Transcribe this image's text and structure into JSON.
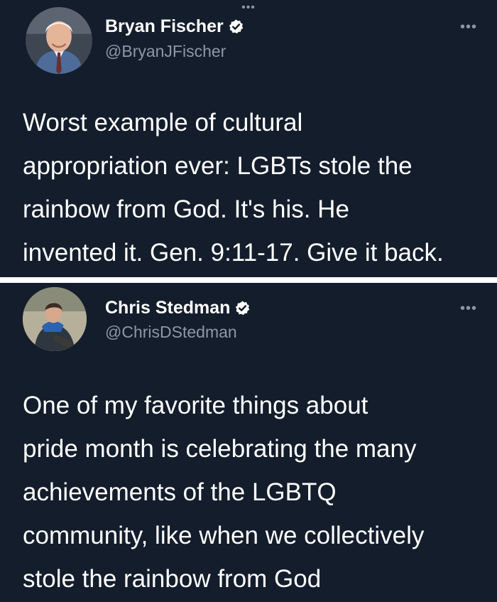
{
  "tweets": [
    {
      "author_name": "Bryan Fischer",
      "handle": "@BryanJFischer",
      "verified": true,
      "text_lines": [
        "Worst example of cultural",
        "appropriation ever: LGBTs stole the",
        "rainbow from God. It's his. He",
        "invented it. Gen. 9:11-17. Give it back."
      ],
      "more_label": "•••"
    },
    {
      "author_name": "Chris Stedman",
      "handle": "@ChrisDStedman",
      "verified": true,
      "text_lines": [
        "One of my favorite things about",
        "pride month is celebrating the many",
        "achievements of the LGBTQ",
        "community, like when we collectively",
        "stole the rainbow from God"
      ],
      "more_label": "•••"
    }
  ],
  "top_dots": "•••",
  "colors": {
    "background": "#141d2b",
    "text": "#ffffff",
    "secondary_text": "#8b98a5",
    "verified_badge": "#ffffff",
    "divider": "#ffffff"
  },
  "icons": {
    "verified": "verified-badge-icon",
    "more": "more-options-icon"
  }
}
